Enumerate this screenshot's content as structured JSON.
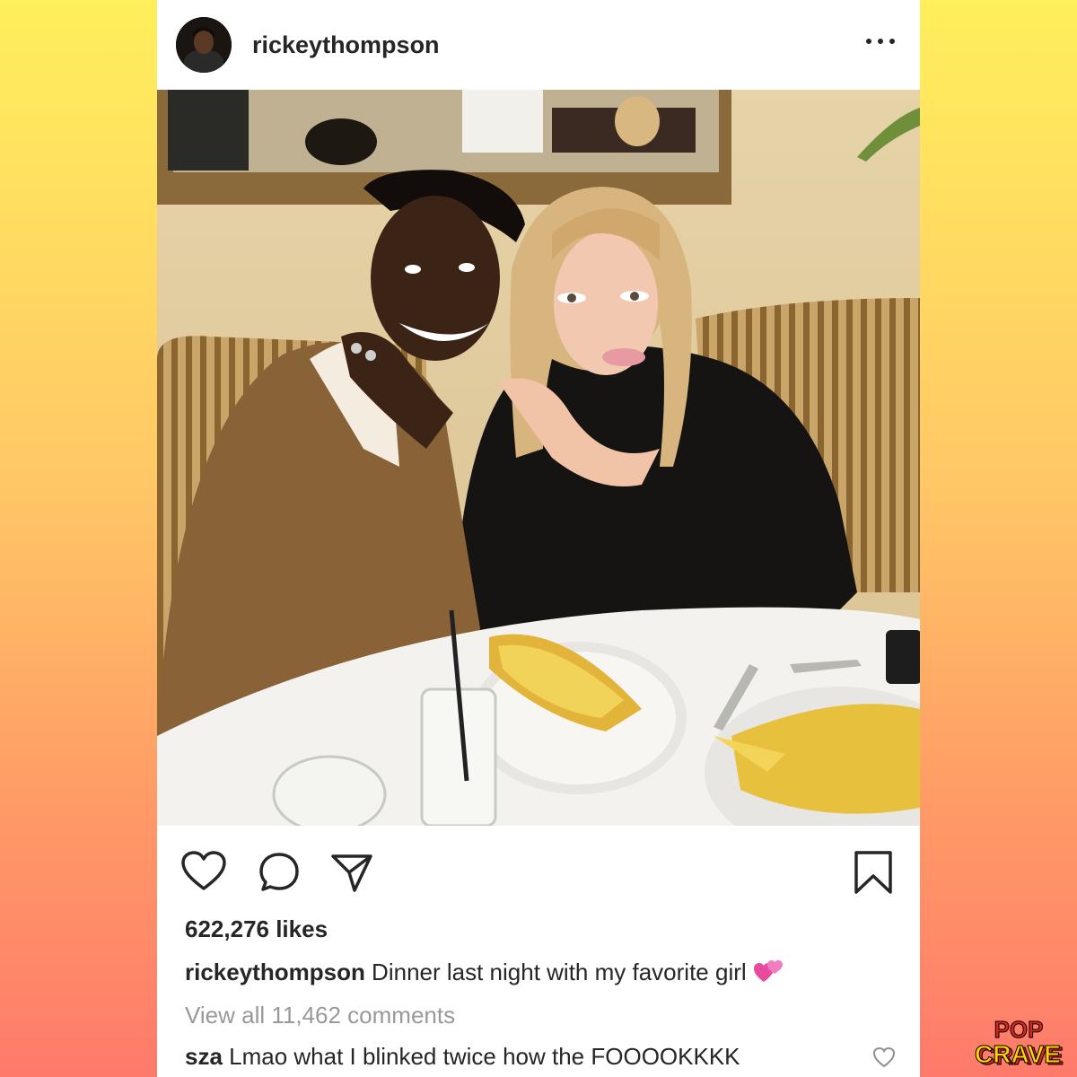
{
  "post": {
    "username": "rickeythompson",
    "likes": "622,276 likes",
    "caption_user": "rickeythompson",
    "caption_text": " Dinner last night with my favorite girl",
    "view_comments": "View all 11,462 comments",
    "comment_user": "sza",
    "comment_text": " Lmao what I blinked twice how the FOOOOKKKK"
  },
  "icons": {
    "like": "heart-icon",
    "comment": "speech-bubble-icon",
    "share": "paper-plane-icon",
    "save": "bookmark-icon",
    "menu": "more-dots-icon",
    "caption_emoji": "two-hearts-emoji",
    "comment_like": "heart-icon"
  },
  "brand": {
    "logo_top": "POP",
    "logo_bottom": "CRAVE",
    "logo_fill": "#ffd400",
    "logo_shadow": "#d9261c"
  },
  "colors": {
    "text": "#262626",
    "muted": "#999999",
    "gradient_top": "#ffef5c",
    "gradient_bottom": "#ff7a6b"
  }
}
